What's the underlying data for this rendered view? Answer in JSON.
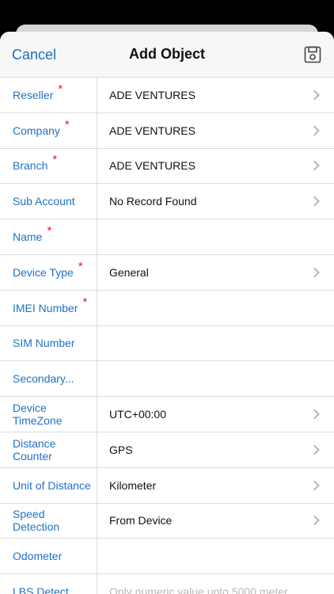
{
  "nav": {
    "cancel_label": "Cancel",
    "title": "Add Object",
    "save_icon": "floppy-disk-icon"
  },
  "rows": [
    {
      "label": "Reseller",
      "required": "*",
      "value": "ADE VENTURES",
      "chevron": true
    },
    {
      "label": "Company",
      "required": "*",
      "value": "ADE VENTURES",
      "chevron": true
    },
    {
      "label": "Branch",
      "required": "*",
      "value": "ADE VENTURES",
      "chevron": true
    },
    {
      "label": "Sub Account",
      "required": "",
      "value": "No Record Found",
      "chevron": true
    },
    {
      "label": "Name",
      "required": "*",
      "value": "",
      "chevron": false
    },
    {
      "label": "Device Type",
      "required": "*",
      "value": "General",
      "chevron": true
    },
    {
      "label": "IMEI Number",
      "required": "*",
      "value": "",
      "chevron": false
    },
    {
      "label": "SIM Number",
      "required": "",
      "value": "",
      "chevron": false
    },
    {
      "label": "Secondary...",
      "required": "",
      "value": "",
      "chevron": false
    },
    {
      "label": "Device TimeZone",
      "required": "",
      "value": "UTC+00:00",
      "chevron": true
    },
    {
      "label": "Distance Counter",
      "required": "",
      "value": "GPS",
      "chevron": true
    },
    {
      "label": "Unit of Distance",
      "required": "",
      "value": "Kilometer",
      "chevron": true
    },
    {
      "label": "Speed Detection",
      "required": "",
      "value": "From Device",
      "chevron": true
    },
    {
      "label": "Odometer",
      "required": "",
      "value": "",
      "chevron": false
    },
    {
      "label": "LBS Detect",
      "required": "",
      "placeholder": "Only numeric value upto 5000 meter",
      "chevron": false
    }
  ],
  "colors": {
    "accent": "#1f72c4",
    "required": "#e02020"
  }
}
